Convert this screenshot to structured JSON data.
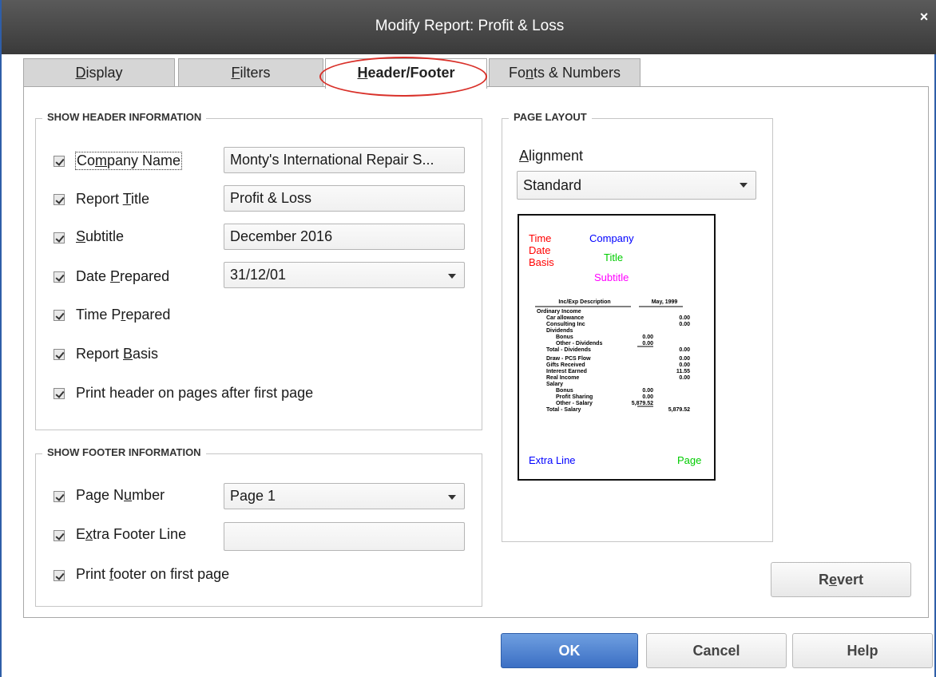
{
  "window": {
    "title": "Modify Report: Profit & Loss",
    "close_glyph": "×"
  },
  "tabs": [
    {
      "pre": "",
      "key": "D",
      "post": "isplay"
    },
    {
      "pre": "",
      "key": "F",
      "post": "ilters"
    },
    {
      "pre": "",
      "key": "H",
      "post": "eader/Footer"
    },
    {
      "pre": "Fo",
      "key": "n",
      "post": "ts & Numbers"
    }
  ],
  "header_section": {
    "title": "SHOW HEADER INFORMATION",
    "company_name": {
      "pre": "Co",
      "key": "m",
      "post": "pany Name",
      "value": "Monty's International Repair S..."
    },
    "report_title": {
      "pre": "Report ",
      "key": "T",
      "post": "itle",
      "value": "Profit & Loss"
    },
    "subtitle": {
      "pre": "",
      "key": "S",
      "post": "ubtitle",
      "value": "December 2016"
    },
    "date_prepared": {
      "pre": "Date ",
      "key": "P",
      "post": "repared",
      "value": "31/12/01"
    },
    "time_prepared": {
      "pre": "Time P",
      "key": "r",
      "post": "epared"
    },
    "report_basis": {
      "pre": "Report ",
      "key": "B",
      "post": "asis"
    },
    "print_header": {
      "pre": "Print header on pa",
      "key": "g",
      "post": "es after first page"
    }
  },
  "footer_section": {
    "title": "SHOW FOOTER INFORMATION",
    "page_number": {
      "pre": "Page N",
      "key": "u",
      "post": "mber",
      "value": "Page 1"
    },
    "extra_footer": {
      "pre": "E",
      "key": "x",
      "post": "tra Footer Line",
      "value": ""
    },
    "print_footer": {
      "pre": "Print ",
      "key": "f",
      "post": "ooter on first page"
    }
  },
  "page_layout": {
    "title": "PAGE LAYOUT",
    "alignment_label": {
      "pre": "",
      "key": "A",
      "post": "lignment"
    },
    "alignment_value": "Standard",
    "preview": {
      "time": "Time",
      "date": "Date",
      "basis": "Basis",
      "company": "Company",
      "title": "Title",
      "subtitle": "Subtitle",
      "extra_line": "Extra Line",
      "page": "Page",
      "col_desc": "Inc/Exp Description",
      "col_period": "May, 1999",
      "rows": [
        {
          "label": "Ordinary Income",
          "value": "",
          "indent": 0
        },
        {
          "label": "Car allowance",
          "value": "0.00",
          "indent": 1
        },
        {
          "label": "Consulting Inc",
          "value": "0.00",
          "indent": 1
        },
        {
          "label": "Dividends",
          "value": "",
          "indent": 1
        },
        {
          "label": "Bonus",
          "value": "0.00",
          "indent": 2
        },
        {
          "label": "Other - Dividends",
          "value": "0.00",
          "indent": 2
        },
        {
          "label": "Total - Dividends",
          "value": "0.00",
          "indent": 1
        },
        {
          "label": "Draw - PCS Flow",
          "value": "0.00",
          "indent": 1
        },
        {
          "label": "Gifts Received",
          "value": "0.00",
          "indent": 1
        },
        {
          "label": "Interest Earned",
          "value": "11.55",
          "indent": 1
        },
        {
          "label": "Real Income",
          "value": "0.00",
          "indent": 1
        },
        {
          "label": "Salary",
          "value": "",
          "indent": 1
        },
        {
          "label": "Bonus",
          "value": "0.00",
          "indent": 2
        },
        {
          "label": "Profit Sharing",
          "value": "0.00",
          "indent": 2
        },
        {
          "label": "Other - Salary",
          "value": "5,879.52",
          "indent": 2
        },
        {
          "label": "Total - Salary",
          "value": "5,879.52",
          "indent": 1
        }
      ]
    }
  },
  "buttons": {
    "revert": {
      "pre": "R",
      "key": "e",
      "post": "vert"
    },
    "ok": "OK",
    "cancel": "Cancel",
    "help": "Help"
  },
  "colors": {
    "time_date_basis": "#ff0000",
    "company": "#0000ff",
    "title": "#00cc00",
    "subtitle": "#ff00ff",
    "extra_line": "#0000ff",
    "page": "#00cc00",
    "highlight": "#d9312a",
    "ok_button": "#3b6fc4"
  }
}
